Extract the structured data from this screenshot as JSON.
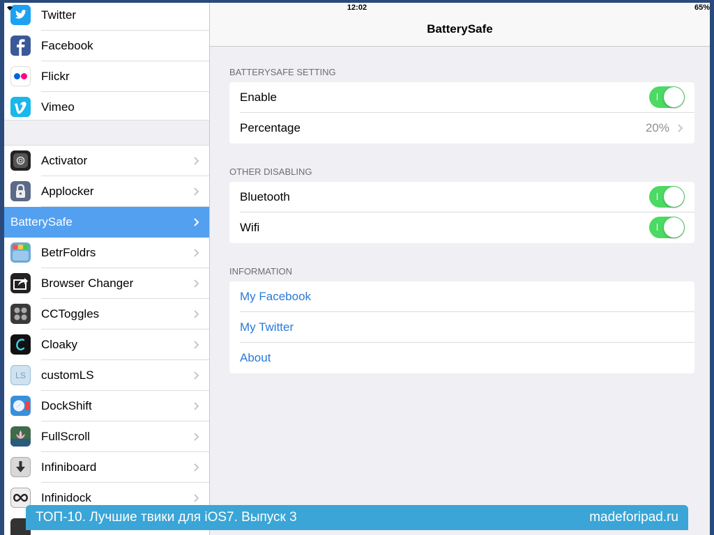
{
  "status": {
    "time": "12:02",
    "battery": "65%"
  },
  "sidebar": {
    "social": [
      {
        "label": "Twitter",
        "icon": "twitter-icon",
        "color": "#1da1f2"
      },
      {
        "label": "Facebook",
        "icon": "facebook-icon",
        "color": "#3b5998"
      },
      {
        "label": "Flickr",
        "icon": "flickr-icon",
        "color": "#ffffff"
      },
      {
        "label": "Vimeo",
        "icon": "vimeo-icon",
        "color": "#1ab7ea"
      }
    ],
    "tweaks": [
      {
        "label": "Activator",
        "icon": "activator-icon"
      },
      {
        "label": "Applocker",
        "icon": "lock-icon"
      },
      {
        "label": "BatterySafe",
        "icon": "battery-icon",
        "selected": true
      },
      {
        "label": "BetrFoldrs",
        "icon": "folders-icon"
      },
      {
        "label": "Browser Changer",
        "icon": "share-icon"
      },
      {
        "label": "CCToggles",
        "icon": "toggles-icon"
      },
      {
        "label": "Cloaky",
        "icon": "cloaky-icon"
      },
      {
        "label": "customLS",
        "icon": "customls-icon"
      },
      {
        "label": "DockShift",
        "icon": "dockshift-icon"
      },
      {
        "label": "FullScroll",
        "icon": "lotus-icon"
      },
      {
        "label": "Infiniboard",
        "icon": "download-icon"
      },
      {
        "label": "Infinidock",
        "icon": "infinity-icon"
      }
    ]
  },
  "nav": {
    "title": "BatterySafe"
  },
  "sections": {
    "battery": {
      "header": "BATTERYSAFE SETTING",
      "enable_label": "Enable",
      "percentage_label": "Percentage",
      "percentage_value": "20%"
    },
    "other": {
      "header": "OTHER DISABLING",
      "bluetooth_label": "Bluetooth",
      "wifi_label": "Wifi"
    },
    "info": {
      "header": "INFORMATION",
      "facebook_label": "My Facebook",
      "twitter_label": "My Twitter",
      "about_label": "About"
    }
  },
  "toggles": {
    "enable": true,
    "bluetooth": true,
    "wifi": true
  },
  "banner": {
    "title": "ТОП-10. Лучшие твики для iOS7. Выпуск 3",
    "site": "madeforipad.ru"
  },
  "colors": {
    "accent": "#53a0f0",
    "toggle_on": "#4cd964",
    "link": "#2a7ad8",
    "banner": "#3aa5d6"
  }
}
